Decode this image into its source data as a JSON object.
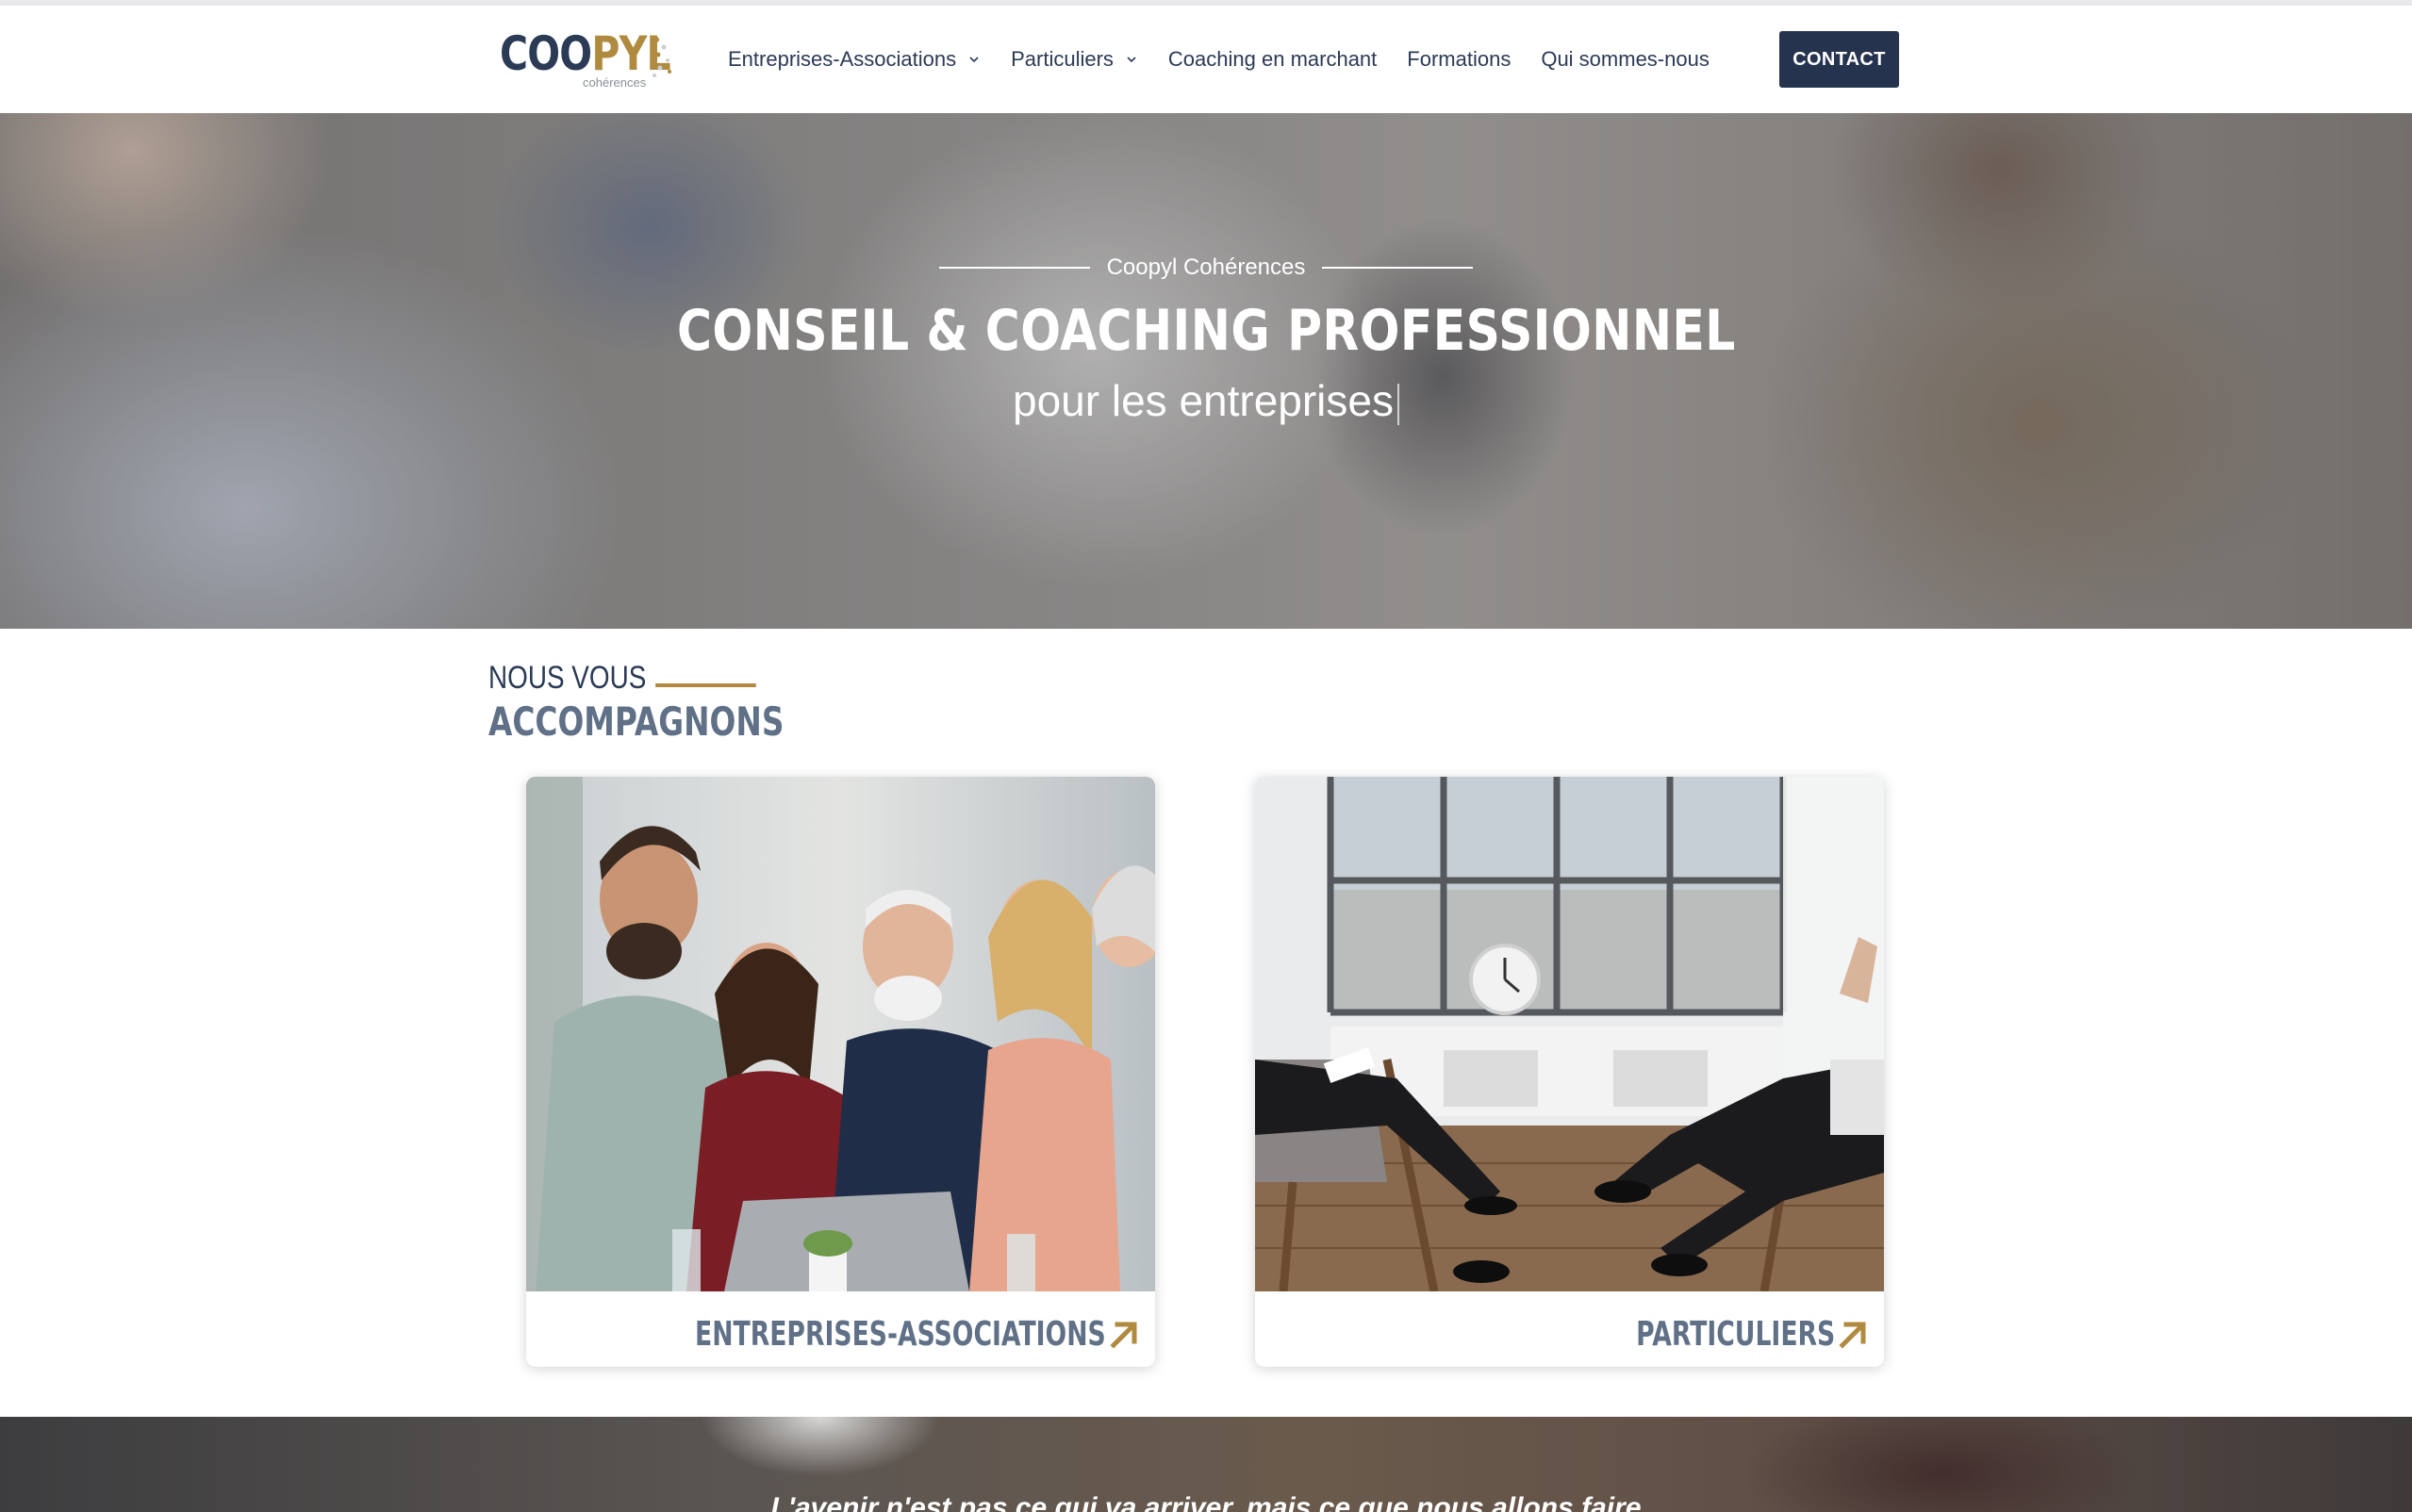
{
  "header": {
    "logo": {
      "part1": "COO",
      "part2": "PYL",
      "subtitle": "cohérences"
    },
    "nav": [
      {
        "label": "Entreprises-Associations",
        "has_dropdown": true
      },
      {
        "label": "Particuliers",
        "has_dropdown": true
      },
      {
        "label": "Coaching en marchant",
        "has_dropdown": false
      },
      {
        "label": "Formations",
        "has_dropdown": false
      },
      {
        "label": "Qui sommes-nous",
        "has_dropdown": false
      }
    ],
    "contact_label": "CONTACT"
  },
  "hero": {
    "eyebrow": "Coopyl Cohérences",
    "title": "CONSEIL & COACHING PROFESSIONNEL",
    "subtitle_prefix": "pour les",
    "subtitle_word": "entreprises"
  },
  "section": {
    "title_line1": "NOUS VOUS",
    "title_line2": "ACCOMPAGNONS",
    "cards": [
      {
        "label": "ENTREPRISES-ASSOCIATIONS",
        "icon": "arrow-up-right-icon"
      },
      {
        "label": "PARTICULIERS",
        "icon": "arrow-up-right-icon"
      }
    ]
  },
  "band": {
    "quote": "L'avenir n'est pas ce qui va arriver, mais ce que nous allons faire"
  },
  "colors": {
    "navy": "#26334f",
    "gold": "#b08a3e",
    "slate": "#5f7087"
  }
}
